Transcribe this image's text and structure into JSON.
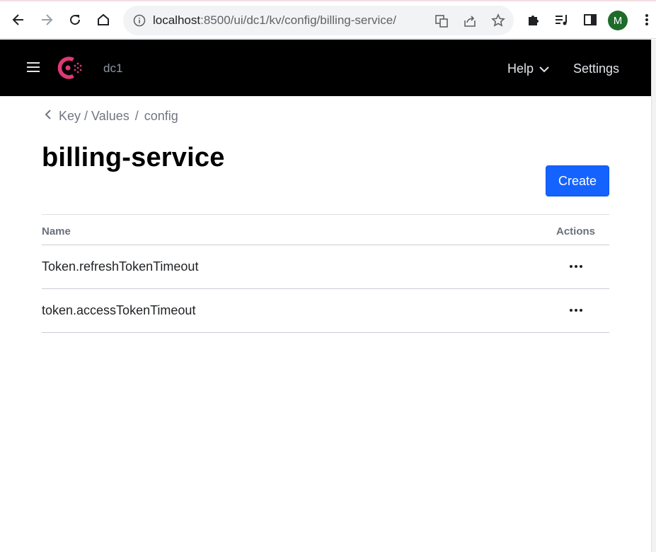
{
  "browser": {
    "url_host": "localhost",
    "url_rest": ":8500/ui/dc1/kv/config/billing-service/",
    "profile_initial": "M"
  },
  "header": {
    "datacenter": "dc1",
    "help_label": "Help",
    "settings_label": "Settings"
  },
  "breadcrumb": {
    "items": [
      "Key / Values",
      "config"
    ],
    "separator": "/"
  },
  "page": {
    "title": "billing-service",
    "create_label": "Create"
  },
  "table": {
    "columns": [
      "Name",
      "Actions"
    ],
    "rows": [
      {
        "name": "Token.refreshTokenTimeout"
      },
      {
        "name": "token.accessTokenTimeout"
      }
    ]
  },
  "colors": {
    "brand": "#e03875",
    "primary_button": "#1563ff",
    "header_bg": "#000000"
  }
}
